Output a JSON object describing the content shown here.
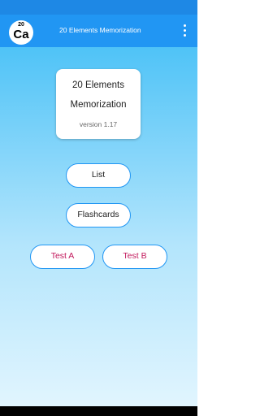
{
  "app_bar": {
    "logo": {
      "number": "20",
      "symbol": "Ca"
    },
    "title": "20 Elements Memorization",
    "menu_icon": "more-vert-icon"
  },
  "card": {
    "line1": "20 Elements",
    "line2": "Memorization",
    "version": "version  1.17"
  },
  "buttons": {
    "list": "List",
    "flashcards": "Flashcards",
    "test_a": "Test A",
    "test_b": "Test B"
  },
  "colors": {
    "app_bar": "#2196f3",
    "status_bar": "#1e88e5",
    "button_border": "#2196f3",
    "test_text": "#c2185b"
  }
}
